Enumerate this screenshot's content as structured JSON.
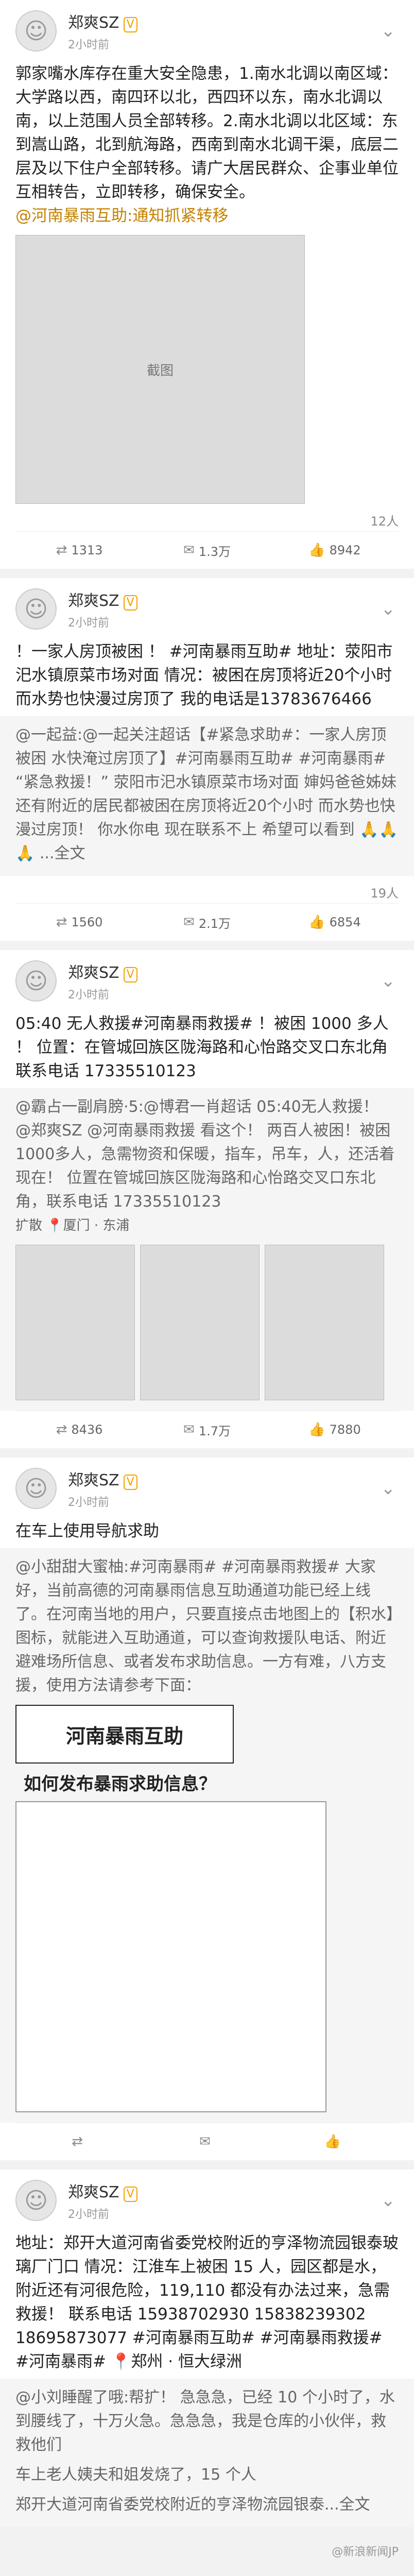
{
  "posts": [
    {
      "user": "郑爽SZ",
      "vip": "V",
      "time": "2小时前",
      "text": "郭家嘴水库存在重大安全隐患，1.南水北调以南区域：大学路以西，南四环以北，西四环以东，南水北调以南，以上范围人员全部转移。2.南水北调以北区域：东到嵩山路，北到航海路，西南到南水北调干渠，底层二层及以下住户全部转移。请广大居民群众、企事业单位互相转告，立即转移，确保安全。",
      "link": "@河南暴雨互助:通知抓紧转移",
      "image_caption": "截图",
      "likes": "12人",
      "repost": "1313",
      "comment": "1.3万",
      "like": "8942"
    },
    {
      "user": "郑爽SZ",
      "vip": "V",
      "time": "2小时前",
      "text": "！一家人房顶被困 ！ #河南暴雨互助# 地址：荥阳市汜水镇原菜市场对面 情况：被困在房顶将近20个小时 而水势也快漫过房顶了 我的电话是13783676466",
      "repost_text": "@一起益:@一起关注超话【#紧急求助#：一家人房顶被困 水快淹过房顶了】#河南暴雨互助# #河南暴雨# “紧急救援！” 荥阳市汜水镇原菜市场对面 婶妈爸爸姊妹还有附近的居民都被困在房顶将近20个小时 而水势也快漫过房顶！ 你水你电 现在联系不上 希望可以看到 🙏🙏🙏 ...全文",
      "likes": "19人",
      "repost": "1560",
      "comment": "2.1万",
      "like": "6854"
    },
    {
      "user": "郑爽SZ",
      "vip": "V",
      "time": "2小时前",
      "text": "05:40 无人救援#河南暴雨救援# ！被困 1000 多人 ！ 位置：在管城回族区陇海路和心怡路交叉口东北角 联系电话 17335510123",
      "repost_text": "@霸占一副肩膀·5:@博君一肖超话 05:40无人救援！ @郑爽SZ @河南暴雨救援 看这个！ 两百人被困！被困1000多人，急需物资和保暖，指车，吊车，人，还活着现在！ 位置在管城回族区陇海路和心怡路交叉口东北角，联系电话 17335510123",
      "location": "扩散 📍厦门 · 东浦",
      "likes": "",
      "repost": "8436",
      "comment": "1.7万",
      "like": "7880"
    },
    {
      "user": "郑爽SZ",
      "vip": "V",
      "time": "2小时前",
      "text": "在车上使用导航求助",
      "repost_text": "@小甜甜大蜜柚:#河南暴雨# #河南暴雨救援# 大家好，当前高德的河南暴雨信息互助通道功能已经上线了。在河南当地的用户，只要直接点击地图上的【积水】图标，就能进入互助通道，可以查询救援队电话、附近避难场所信息、或者发布求助信息。一方有难，八方支援，使用方法请参考下面：",
      "banner": "河南暴雨互助",
      "question": "如何发布暴雨求助信息？",
      "likes": "",
      "repost": "",
      "comment": "",
      "like": ""
    },
    {
      "user": "郑爽SZ",
      "vip": "V",
      "time": "2小时前",
      "text": "地址：郑开大道河南省委党校附近的亨泽物流园银泰玻璃厂门口 情况：江淮车上被困 15 人，园区都是水，附近还有河很危险，119,110 都没有办法过来，急需救援！ 联系电话 15938702930 15838239302 18695873077 #河南暴雨互助# #河南暴雨救援# #河南暴雨# 📍郑州 · 恒大绿洲",
      "repost_text": "@小刘睡醒了哦:帮扩！ 急急急，已经 10 个小时了，水到腰线了，十万火急。急急急，我是仓库的小伙伴，救救他们",
      "extra1": "车上老人姨夫和姐发烧了，15 个人",
      "extra2": "郑开大道河南省委党校附近的亨泽物流园银泰...全文",
      "likes": "",
      "repost": "",
      "comment": "",
      "like": ""
    }
  ],
  "footer": "@新浪新闻JP"
}
